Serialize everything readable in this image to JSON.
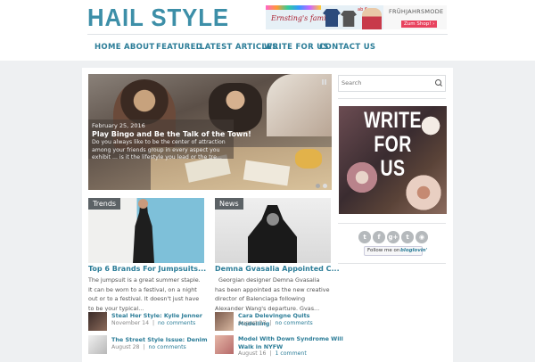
{
  "site": {
    "logo": "HAIL STYLE"
  },
  "ad": {
    "brand": "Ernsting's family",
    "price": "ab 6,-",
    "headline": "FRÜHJAHRSMODE",
    "cta": "Zum Shop! ›"
  },
  "nav": {
    "items": [
      "HOME",
      "ABOUT",
      "FEATURED",
      "LATEST ARTICLES",
      "WRITE FOR US",
      "CONTACT US"
    ]
  },
  "slider": {
    "date": "February 25, 2016",
    "title": "Play Bingo and Be the Talk of the Town!",
    "excerpt": "Do you always like to be the center of attraction among your friends group in every aspect you exhibit ... is it the lifestyle you lead or the tre..."
  },
  "posts": [
    {
      "category": "Trends",
      "title": "Top 6 Brands For Jumpsuits...",
      "excerpt": "The jumpsuit is a great summer staple. It can be worn to a festival, on a night out or to a festival. It doesn't just have to be your typical..."
    },
    {
      "category": "News",
      "title": "Demna Gvasalia Appointed C...",
      "excerpt": "Georgian designer Demna Gvasalia has been appointed as the new creative director of Balenciaga following Alexander Wang's departure. Gvas..."
    }
  ],
  "mini_posts": [
    {
      "title": "Steal Her Style: Kylie Jenner",
      "date": "November 14",
      "comments": "no comments"
    },
    {
      "title": "Cara Delevingne Quits Modelling",
      "date": "August 23",
      "comments": "no comments"
    },
    {
      "title": "The Street Style Issue: Denim",
      "date": "August 28",
      "comments": "no comments"
    },
    {
      "title": "Model With Down Syndrome Will Walk in NYFW",
      "date": "August 16",
      "comments": "1 comment"
    }
  ],
  "sidebar": {
    "search_placeholder": "Search",
    "write_banner": [
      "WRITE",
      "FOR",
      "US"
    ],
    "social_icons": [
      "twitter-icon",
      "facebook-icon",
      "google-plus-icon",
      "tumblr-icon",
      "rss-icon"
    ],
    "social_glyphs": [
      "t",
      "f",
      "g+",
      "t",
      "◉"
    ],
    "follow_text": "Follow me on",
    "follow_brand": "bloglovin'"
  }
}
